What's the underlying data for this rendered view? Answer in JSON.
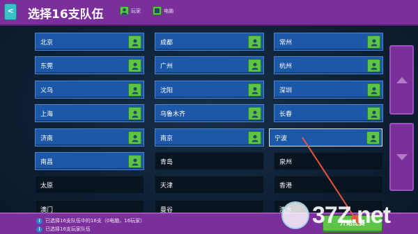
{
  "header": {
    "back_label": "<",
    "title": "选择16支队伍",
    "legend_player": "玩家",
    "legend_cpu": "电脑"
  },
  "teams": [
    {
      "name": "北京",
      "human": true,
      "active": true
    },
    {
      "name": "成都",
      "human": true,
      "active": true
    },
    {
      "name": "常州",
      "human": true,
      "active": true
    },
    {
      "name": "东莞",
      "human": true,
      "active": true
    },
    {
      "name": "广州",
      "human": true,
      "active": true
    },
    {
      "name": "杭州",
      "human": true,
      "active": true
    },
    {
      "name": "义乌",
      "human": true,
      "active": true
    },
    {
      "name": "沈阳",
      "human": true,
      "active": true
    },
    {
      "name": "深圳",
      "human": true,
      "active": true
    },
    {
      "name": "上海",
      "human": true,
      "active": true
    },
    {
      "name": "乌鲁木齐",
      "human": true,
      "active": true
    },
    {
      "name": "长春",
      "human": true,
      "active": true
    },
    {
      "name": "济南",
      "human": true,
      "active": true
    },
    {
      "name": "南京",
      "human": true,
      "active": true
    },
    {
      "name": "宁波",
      "human": true,
      "active": true,
      "selected": true
    },
    {
      "name": "南昌",
      "human": true,
      "active": true
    },
    {
      "name": "青岛",
      "human": false,
      "active": false
    },
    {
      "name": "泉州",
      "human": false,
      "active": false
    },
    {
      "name": "太原",
      "human": false,
      "active": false
    },
    {
      "name": "天津",
      "human": false,
      "active": false
    },
    {
      "name": "香港",
      "human": false,
      "active": false
    },
    {
      "name": "澳门",
      "human": false,
      "active": false
    },
    {
      "name": "曼谷",
      "human": false,
      "active": false
    },
    {
      "name": "澳水",
      "human": false,
      "active": false
    }
  ],
  "status": {
    "line1": "已选择16支队伍中的16支（0电脑，16玩家）",
    "line2": "已选择16支玩家队伍"
  },
  "start_label": "开始比赛",
  "watermark": {
    "text": "37Z.net"
  },
  "colors": {
    "topbar": "#7a2f9a",
    "team_active": "#1d58a8",
    "team_inactive": "#081420",
    "player_icon": "#5cc447",
    "arrow": "#e8573b"
  }
}
